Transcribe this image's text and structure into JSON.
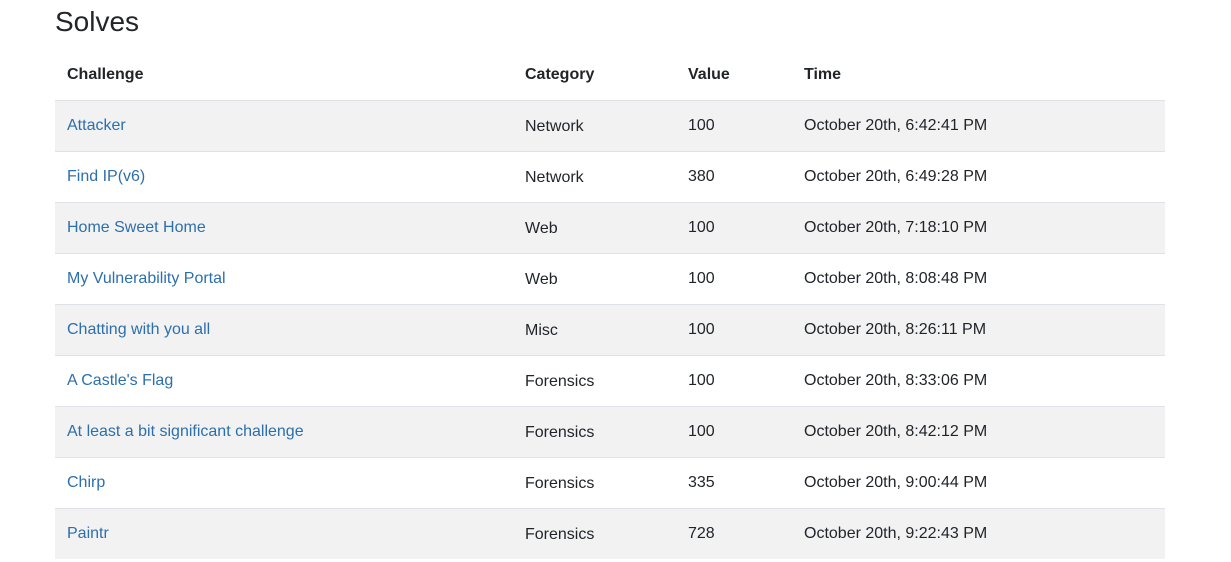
{
  "section": {
    "title": "Solves"
  },
  "columns": {
    "challenge": "Challenge",
    "category": "Category",
    "value": "Value",
    "time": "Time"
  },
  "solves": [
    {
      "challenge": "Attacker",
      "category": "Network",
      "value": "100",
      "time": "October 20th, 6:42:41 PM"
    },
    {
      "challenge": "Find IP(v6)",
      "category": "Network",
      "value": "380",
      "time": "October 20th, 6:49:28 PM"
    },
    {
      "challenge": "Home Sweet Home",
      "category": "Web",
      "value": "100",
      "time": "October 20th, 7:18:10 PM"
    },
    {
      "challenge": "My Vulnerability Portal",
      "category": "Web",
      "value": "100",
      "time": "October 20th, 8:08:48 PM"
    },
    {
      "challenge": "Chatting with you all",
      "category": "Misc",
      "value": "100",
      "time": "October 20th, 8:26:11 PM"
    },
    {
      "challenge": "A Castle's Flag",
      "category": "Forensics",
      "value": "100",
      "time": "October 20th, 8:33:06 PM"
    },
    {
      "challenge": "At least a bit significant challenge",
      "category": "Forensics",
      "value": "100",
      "time": "October 20th, 8:42:12 PM"
    },
    {
      "challenge": "Chirp",
      "category": "Forensics",
      "value": "335",
      "time": "October 20th, 9:00:44 PM"
    },
    {
      "challenge": "Paintr",
      "category": "Forensics",
      "value": "728",
      "time": "October 20th, 9:22:43 PM"
    }
  ],
  "colors": {
    "link": "#2c6fad",
    "stripe": "#f2f2f2",
    "text": "#212529"
  }
}
